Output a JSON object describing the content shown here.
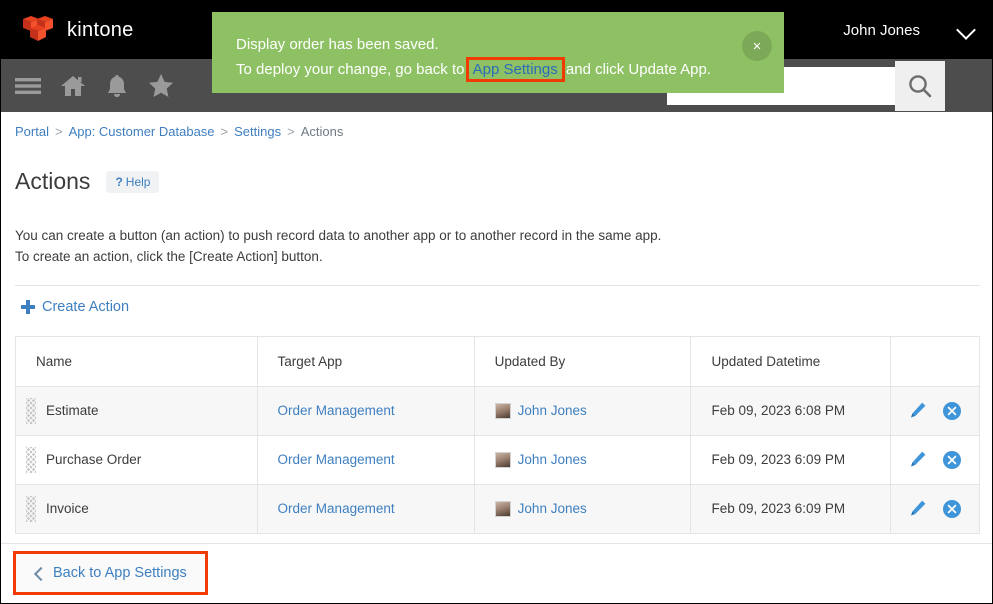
{
  "header": {
    "brand": "kintone",
    "logo_icon": "kintone-cube-logo",
    "user_name": "John Jones",
    "user_menu_icon": "chevron-down-icon",
    "accent_color": "#e8411f"
  },
  "toolbar": {
    "icons": [
      {
        "name": "hamburger-menu-icon",
        "label": "Menu"
      },
      {
        "name": "home-icon",
        "label": "Home"
      },
      {
        "name": "notification-bell-icon",
        "label": "Notifications"
      },
      {
        "name": "favorites-star-icon",
        "label": "Favorites"
      }
    ],
    "search": {
      "value": "",
      "placeholder": "",
      "button_icon": "search-icon"
    },
    "background_color": "#4d4d4d"
  },
  "banner": {
    "line1": "Display order has been saved.",
    "line2_prefix": "To deploy your change, go back to ",
    "link_label": "App Settings",
    "line2_suffix": " and click Update App.",
    "close_icon": "close-icon",
    "close_label": "×",
    "background_color": "#8ec164",
    "link_color": "#2b6cb8",
    "highlight_color": "#f03c02"
  },
  "breadcrumb": {
    "items": [
      {
        "label": "Portal",
        "link": true
      },
      {
        "label": "App: Customer Database",
        "link": true
      },
      {
        "label": "Settings",
        "link": true
      },
      {
        "label": "Actions",
        "link": false
      }
    ],
    "separator": ">"
  },
  "page": {
    "title": "Actions",
    "help_badge": {
      "icon": "question-mark-icon",
      "symbol": "?",
      "label": "Help"
    },
    "description_line1": "You can create a button (an action) to push record data to another app or to another record in the same app.",
    "description_line2": "To create an action, click the [Create Action] button.",
    "create_action_label": "Create Action",
    "create_action_icon": "plus-icon"
  },
  "table": {
    "columns": [
      "Name",
      "Target App",
      "Updated By",
      "Updated Datetime",
      ""
    ],
    "rows": [
      {
        "grip_icon": "drag-handle-icon",
        "name": "Estimate",
        "target_app": "Order Management",
        "updated_by": "John Jones",
        "avatar_icon": "user-avatar",
        "updated_datetime": "Feb 09, 2023 6:08 PM",
        "edit_icon": "pencil-edit-icon",
        "delete_icon": "delete-circle-icon"
      },
      {
        "grip_icon": "drag-handle-icon",
        "name": "Purchase Order",
        "target_app": "Order Management",
        "updated_by": "John Jones",
        "avatar_icon": "user-avatar",
        "updated_datetime": "Feb 09, 2023 6:09 PM",
        "edit_icon": "pencil-edit-icon",
        "delete_icon": "delete-circle-icon"
      },
      {
        "grip_icon": "drag-handle-icon",
        "name": "Invoice",
        "target_app": "Order Management",
        "updated_by": "John Jones",
        "avatar_icon": "user-avatar",
        "updated_datetime": "Feb 09, 2023 6:09 PM",
        "edit_icon": "pencil-edit-icon",
        "delete_icon": "delete-circle-icon"
      }
    ]
  },
  "footer": {
    "back_label": "Back to App Settings",
    "back_icon": "chevron-left-icon",
    "highlight_color": "#f03c02"
  }
}
